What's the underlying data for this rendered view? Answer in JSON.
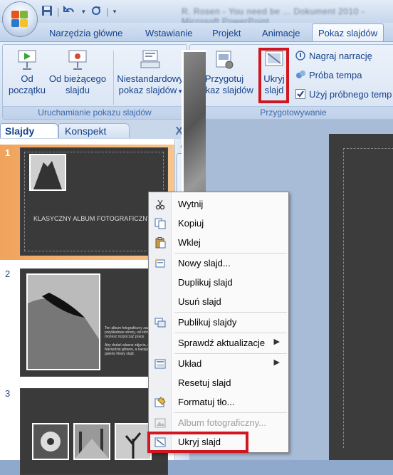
{
  "window": {
    "title_blurred": "R. Rosen - You need be ... Dokument 2010 - Microsoft PowerPoint"
  },
  "qat": {
    "save_icon": "save-icon",
    "undo_icon": "undo-icon",
    "redo_icon": "redo-icon"
  },
  "tabs": [
    {
      "label": "Narzędzia główne"
    },
    {
      "label": "Wstawianie"
    },
    {
      "label": "Projekt"
    },
    {
      "label": "Animacje"
    },
    {
      "label": "Pokaz slajdów"
    }
  ],
  "ribbon": {
    "group1": {
      "label": "Uruchamianie pokazu slajdów",
      "from_start": {
        "line1": "Od",
        "line2": "początku"
      },
      "from_current": {
        "line1": "Od bieżącego",
        "line2": "slajdu"
      },
      "custom": {
        "line1": "Niestandardowy",
        "line2": "pokaz slajdów"
      }
    },
    "group2": {
      "label": "Przygotowywanie",
      "setup": {
        "line1": "Przygotuj",
        "line2": "pokaz slajdów"
      },
      "hide": {
        "line1": "Ukryj",
        "line2": "slajd"
      },
      "record": "Nagraj narrację",
      "rehearse": "Próba tempa",
      "use_timings": "Użyj próbnego temp"
    }
  },
  "pane": {
    "tab_slides": "Slajdy",
    "tab_outline": "Konspekt",
    "close": "X"
  },
  "slides": [
    {
      "num": "1",
      "title": "KLASYCZNY ALBUM FOTOGRAFICZNY"
    },
    {
      "num": "2",
      "text1": "Ten album fotograficzny zawiera przykładowe strony, od których możesz rozpocząć pracę.",
      "text2": "Aby dodać własne zdjęcia, na karcie Narzędzia główne, a następnie kliknij galerię Nowy slajd."
    },
    {
      "num": "3"
    }
  ],
  "context_menu": {
    "items": [
      {
        "label": "Wytnij",
        "icon": "scissors-icon"
      },
      {
        "label": "Kopiuj",
        "icon": "copy-icon"
      },
      {
        "label": "Wklej",
        "icon": "paste-icon"
      },
      {
        "label": "Nowy slajd...",
        "icon": "new-slide-icon"
      },
      {
        "label": "Duplikuj slajd",
        "icon": ""
      },
      {
        "label": "Usuń slajd",
        "icon": ""
      },
      {
        "label": "Publikuj slajdy",
        "icon": "publish-icon"
      },
      {
        "label": "Sprawdź aktualizacje",
        "icon": ""
      },
      {
        "label": "Układ",
        "icon": "layout-icon"
      },
      {
        "label": "Resetuj slajd",
        "icon": ""
      },
      {
        "label": "Formatuj tło...",
        "icon": "format-background-icon"
      },
      {
        "label": "Album fotograficzny...",
        "icon": "photo-album-icon"
      },
      {
        "label": "Ukryj slajd",
        "icon": "hide-slide-icon"
      }
    ]
  },
  "colors": {
    "highlight_red": "#d0161f",
    "ribbon_text": "#15428b",
    "selected_slide": "#f0a35c"
  }
}
